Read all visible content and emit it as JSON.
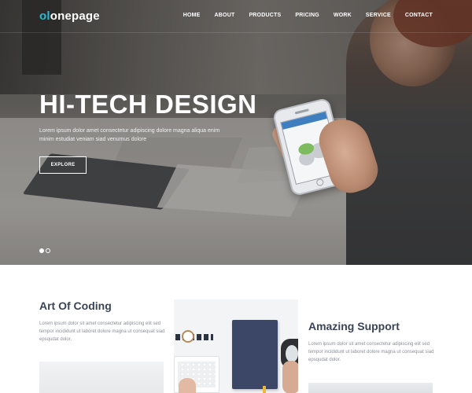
{
  "brand": {
    "mark": "ol",
    "name": "onepage"
  },
  "nav": {
    "items": [
      "HOME",
      "ABOUT",
      "PRODUCTS",
      "PRICING",
      "WORK",
      "SERVICE",
      "CONTACT"
    ]
  },
  "hero": {
    "title": "HI-TECH DESIGN",
    "subtitle": "Lorem ipsum dolor amet consectetur adipiscing dolore magna aliqua enim minim estudiat veniam siad venumus dolore",
    "button": "EXPLORE",
    "slider": {
      "slides": 2,
      "active": 1
    }
  },
  "features": {
    "left": {
      "title": "Art Of Coding",
      "text": "Lorem ipsum dolor sit amet consectetur adipiscing elit sed tempor incididunt ut laboret dolore magna ut consequat siad epsqudat dolor."
    },
    "right": {
      "title": "Amazing Support",
      "text": "Lorem ipsum dolor sit amet consectetur adipiscing elit sed tempor incididunt ut laboret dolore magna ut consequat siad epsqudat dolor."
    }
  },
  "colors": {
    "accent": "#2bb8d4",
    "heading": "#3a4457",
    "body_text": "#8b8f96"
  }
}
